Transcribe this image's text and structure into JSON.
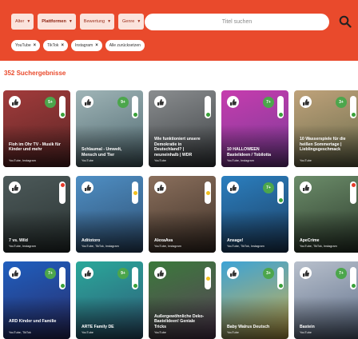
{
  "filters": {
    "items": [
      {
        "label": "Alter",
        "active": false
      },
      {
        "label": "Plattformen",
        "active": true
      },
      {
        "label": "Bewertung",
        "active": false
      },
      {
        "label": "Genre",
        "active": false
      }
    ]
  },
  "search": {
    "placeholder": "Titel suchen"
  },
  "chips": [
    {
      "label": "YouTube"
    },
    {
      "label": "TikTok"
    },
    {
      "label": "Instagram"
    }
  ],
  "reset_label": "Alle zurücksetzen",
  "results_label": "352 Suchergebnisse",
  "cards": [
    {
      "title": "Floh im Ohr TV - Musik für Kinder und mehr",
      "platforms": "YouTube, Instagram",
      "age": "5+",
      "light": "green",
      "bg": [
        "#a23b3b",
        "#5a2626"
      ]
    },
    {
      "title": "Schlaumal - Umwelt, Mensch und Tier",
      "platforms": "YouTube",
      "age": "9+",
      "light": "green",
      "bg": [
        "#9fb4b6",
        "#4e6870"
      ]
    },
    {
      "title": "Wie funktioniert unsere Demokratie in Deutschland? | neuneinhalb | WDR",
      "platforms": "YouTube",
      "age": "",
      "light": "green",
      "bg": [
        "#8a8d8f",
        "#3d4144"
      ]
    },
    {
      "title": "10 HALLOWEEN Bastelideen / Tobilotta",
      "platforms": "YouTube, Instagram",
      "age": "7+",
      "light": "green",
      "bg": [
        "#c63cae",
        "#7b3b98"
      ]
    },
    {
      "title": "10 Wasserspiele für die heißen Sommertage | Lieblingsgeschmack",
      "platforms": "YouTube",
      "age": "3+",
      "light": "green",
      "bg": [
        "#bfa27a",
        "#6a6c4c"
      ]
    },
    {
      "title": "7 vs. Wild",
      "platforms": "YouTube, Instagram",
      "age": "",
      "light": "red",
      "bg": [
        "#4d5a5a",
        "#2a3332"
      ]
    },
    {
      "title": "Aditotoro",
      "platforms": "YouTube, TikTok, Instagram",
      "age": "",
      "light": "yellow",
      "bg": [
        "#4f8fc4",
        "#2e4f72"
      ]
    },
    {
      "title": "AlexaAva",
      "platforms": "YouTube, Instagram",
      "age": "",
      "light": "yellow",
      "bg": [
        "#8a6f5c",
        "#3f3128"
      ]
    },
    {
      "title": "Ansage!",
      "platforms": "YouTube, TikTok, Instagram",
      "age": "7+",
      "light": "green",
      "bg": [
        "#2b7fbf",
        "#1d3f63"
      ]
    },
    {
      "title": "ApeCrime",
      "platforms": "YouTube, TikTok, Instagram",
      "age": "",
      "light": "red",
      "bg": [
        "#6c8d6a",
        "#2c3a2c"
      ]
    },
    {
      "title": "ARD Kinder und Familie",
      "platforms": "YouTube, TikTok",
      "age": "7+",
      "light": "green",
      "bg": [
        "#1f5fbf",
        "#2a2d6a"
      ]
    },
    {
      "title": "ARTE Family DE",
      "platforms": "YouTube",
      "age": "9+",
      "light": "green",
      "bg": [
        "#2aa89a",
        "#2f5a78"
      ]
    },
    {
      "title": "Außergewöhnliche Deko-Bastelideen! Geniale Tricks",
      "platforms": "YouTube",
      "age": "",
      "light": "yellow",
      "bg": [
        "#3b7a3b",
        "#5a3e5a"
      ]
    },
    {
      "title": "Baby Walrus Deutsch",
      "platforms": "YouTube",
      "age": "3+",
      "light": "green",
      "bg": [
        "#3ca3d6",
        "#d0b04a"
      ]
    },
    {
      "title": "Bastein",
      "platforms": "YouTube",
      "age": "7+",
      "light": "green",
      "bg": [
        "#b8c0cc",
        "#5f6f8a"
      ]
    }
  ]
}
